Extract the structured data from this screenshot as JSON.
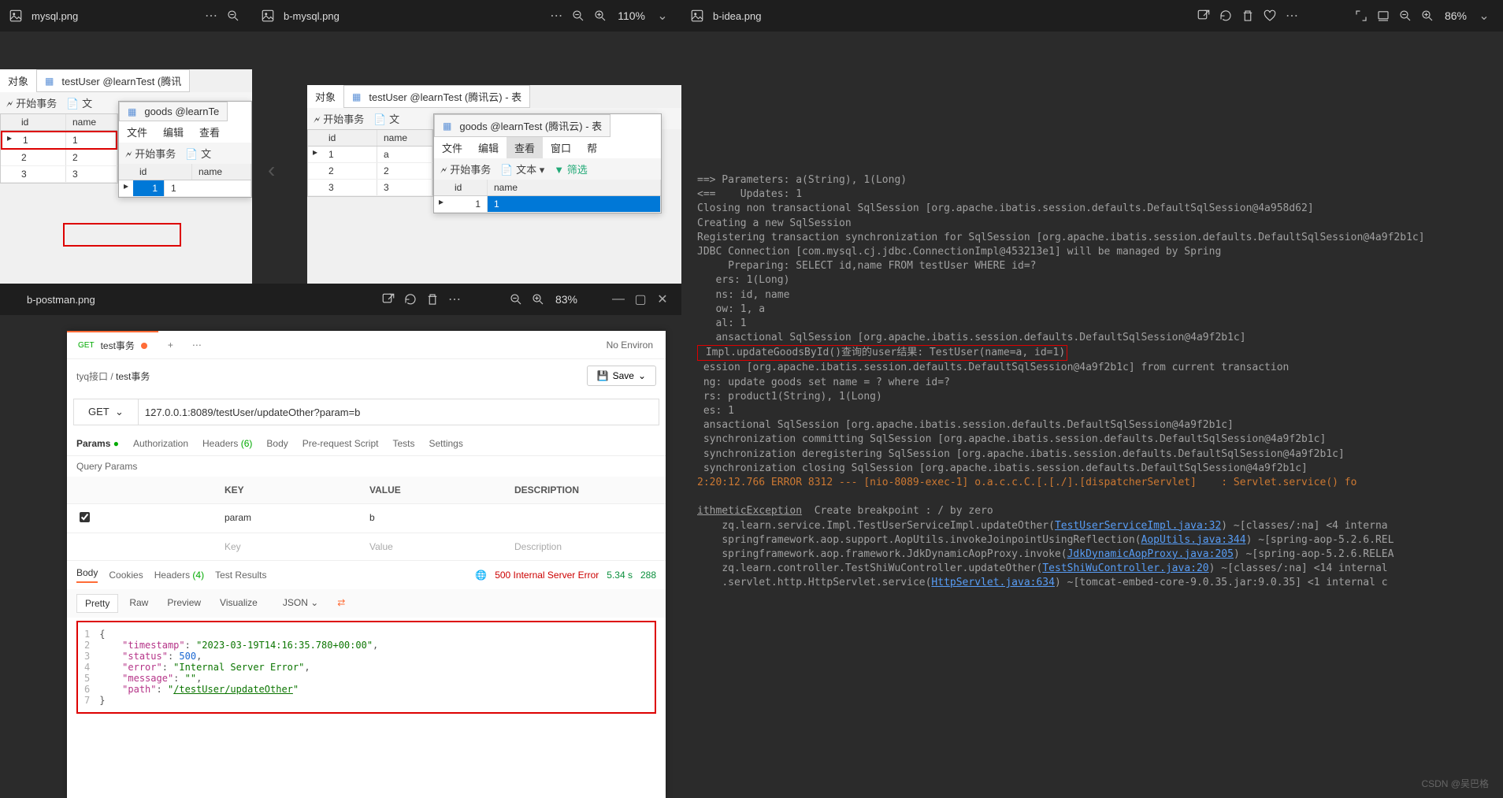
{
  "watermark": "CSDN @吴巴格",
  "panes": {
    "mysql": {
      "filename": "mysql.png",
      "tab_object": "对象",
      "table_title": "testUser @learnTest (腾讯",
      "toolbar": {
        "begin_tx": "开始事务",
        "text": "文"
      },
      "cols": [
        "id",
        "name"
      ],
      "rows": [
        [
          "1",
          "1"
        ],
        [
          "2",
          "2"
        ],
        [
          "3",
          "3"
        ]
      ],
      "inner": {
        "title": "goods @learnTe",
        "menu": [
          "文件",
          "编辑",
          "查看"
        ],
        "begin_tx": "开始事务",
        "text_btn": "文",
        "cols": [
          "id",
          "name"
        ],
        "rows": [
          [
            "1",
            "1"
          ]
        ]
      }
    },
    "bmysql": {
      "filename": "b-mysql.png",
      "zoom": "110%",
      "tab_object": "对象",
      "table_title": "testUser @learnTest (腾讯云) - 表",
      "toolbar": {
        "begin_tx": "开始事务",
        "text": "文"
      },
      "cols": [
        "id",
        "name"
      ],
      "rows": [
        [
          "1",
          "a"
        ],
        [
          "2",
          "2"
        ],
        [
          "3",
          "3"
        ]
      ],
      "inner": {
        "title": "goods @learnTest (腾讯云) - 表",
        "menu": [
          "文件",
          "编辑",
          "查看",
          "窗口",
          "帮"
        ],
        "begin_tx": "开始事务",
        "text_btn": "文本",
        "filter_btn": "筛选",
        "cols": [
          "id",
          "name"
        ],
        "rows": [
          [
            "1",
            "1"
          ]
        ]
      }
    },
    "bidea": {
      "filename": "b-idea.png",
      "zoom": "86%",
      "log_lines": [
        "==> Parameters: a(String), 1(Long)",
        "<==    Updates: 1",
        "Closing non transactional SqlSession [org.apache.ibatis.session.defaults.DefaultSqlSession@4a958d62]",
        "Creating a new SqlSession",
        "Registering transaction synchronization for SqlSession [org.apache.ibatis.session.defaults.DefaultSqlSession@4a9f2b1c]",
        "JDBC Connection [com.mysql.cj.jdbc.ConnectionImpl@453213e1] will be managed by Spring",
        "     Preparing: SELECT id,name FROM testUser WHERE id=?",
        "   ers: 1(Long)",
        "   ns: id, name",
        "   ow: 1, a",
        "   al: 1",
        "   ansactional SqlSession [org.apache.ibatis.session.defaults.DefaultSqlSession@4a9f2b1c]"
      ],
      "highlight_line": " Impl.updateGoodsById()查询的user结果: TestUser(name=a, id=1)",
      "log_lines_after": [
        " ession [org.apache.ibatis.session.defaults.DefaultSqlSession@4a9f2b1c] from current transaction",
        " ng: update goods set name = ? where id=?",
        " rs: product1(String), 1(Long)",
        " es: 1",
        " ansactional SqlSession [org.apache.ibatis.session.defaults.DefaultSqlSession@4a9f2b1c]",
        " synchronization committing SqlSession [org.apache.ibatis.session.defaults.DefaultSqlSession@4a9f2b1c]",
        " synchronization deregistering SqlSession [org.apache.ibatis.session.defaults.DefaultSqlSession@4a9f2b1c]",
        " synchronization closing SqlSession [org.apache.ibatis.session.defaults.DefaultSqlSession@4a9f2b1c]"
      ],
      "error_line": "2:20:12.766 ERROR 8312 --- [nio-8089-exec-1] o.a.c.c.C.[.[./].[dispatcherServlet]    : Servlet.service() fo",
      "exception_line_prefix": "ithmeticException",
      "exception_line_mid": "Create breakpoint : / by zero",
      "stack": [
        {
          "pre": "zq.learn.service.Impl.TestUserServiceImpl.updateOther(",
          "link": "TestUserServiceImpl.java:32",
          "post": ") ~[classes/:na] <4 interna"
        },
        {
          "pre": "springframework.aop.support.AopUtils.invokeJoinpointUsingReflection(",
          "link": "AopUtils.java:344",
          "post": ") ~[spring-aop-5.2.6.REL"
        },
        {
          "pre": "springframework.aop.framework.JdkDynamicAopProxy.invoke(",
          "link": "JdkDynamicAopProxy.java:205",
          "post": ") ~[spring-aop-5.2.6.RELEA"
        },
        {
          "pre": "zq.learn.controller.TestShiWuController.updateOther(",
          "link": "TestShiWuController.java:20",
          "post": ") ~[classes/:na] <14 internal"
        },
        {
          "pre": ".servlet.http.HttpServlet.service(",
          "link": "HttpServlet.java:634",
          "post": ") ~[tomcat-embed-core-9.0.35.jar:9.0.35] <1 internal c"
        }
      ]
    },
    "postman": {
      "filename": "b-postman.png",
      "zoom": "83%",
      "tab": {
        "method": "GET",
        "name": "test事务"
      },
      "env": "No Environ",
      "breadcrumb": [
        "tyq接口",
        "test事务"
      ],
      "save": "Save",
      "method": "GET",
      "url": "127.0.0.1:8089/testUser/updateOther?param=b",
      "req_tabs": [
        "Params",
        "Authorization",
        "Headers",
        "Body",
        "Pre-request Script",
        "Tests",
        "Settings"
      ],
      "headers_count": "(6)",
      "params_dot": "●",
      "query_params_label": "Query Params",
      "param_header": [
        "KEY",
        "VALUE",
        "DESCRIPTION"
      ],
      "param_row": {
        "key": "param",
        "value": "b"
      },
      "placeholder_row": {
        "key": "Key",
        "value": "Value",
        "desc": "Description"
      },
      "resp_tabs": [
        "Body",
        "Cookies",
        "Headers",
        "Test Results"
      ],
      "resp_headers_count": "(4)",
      "status": "500 Internal Server Error",
      "time": "5.34 s",
      "size": "288",
      "pretty_tabs": [
        "Pretty",
        "Raw",
        "Preview",
        "Visualize"
      ],
      "format": "JSON",
      "json": {
        "timestamp": "2023-03-19T14:16:35.780+00:00",
        "status": 500,
        "error": "Internal Server Error",
        "message": "",
        "path": "/testUser/updateOther"
      }
    }
  }
}
